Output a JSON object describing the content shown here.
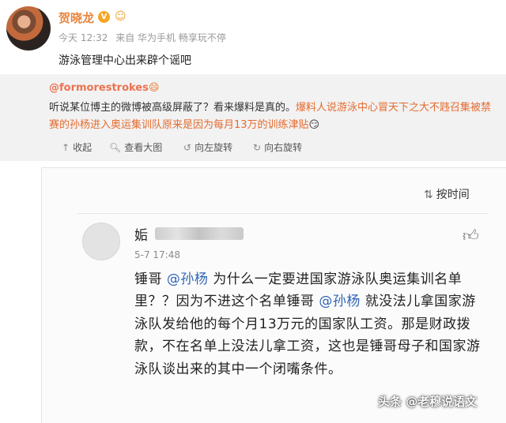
{
  "post": {
    "author": "贺晓龙",
    "verified_badge": "V",
    "meta": {
      "time": "今天 12:32",
      "source": "来自 华为手机 畅享玩不停"
    },
    "text": "游泳管理中心出来辟个谣吧"
  },
  "repost": {
    "author": "@formorestrokes",
    "text_a": "听说某位博主的微博被高级屏蔽了？看来爆料是真的。",
    "text_b": "爆料人说游泳中心冒天下之大不韪召集被禁赛的孙杨进入奥运集训队原来是因为每月13万的训练津贴",
    "actions": [
      {
        "icon": "collapse-icon",
        "label": "收起"
      },
      {
        "icon": "zoom-icon",
        "label": "查看大图"
      },
      {
        "icon": "rotate-left-icon",
        "label": "向左旋转"
      },
      {
        "icon": "rotate-right-icon",
        "label": "向右旋转"
      }
    ]
  },
  "comments": {
    "sort_label": "按时间",
    "item": {
      "name_initial": "姤",
      "time": "5-7 17:48",
      "t1": "锤哥",
      "m1": "@孙杨",
      "t2": "为什么一定要进国家游泳队奥运集训名单里？？因为不进这个名单锤哥",
      "m2": "@孙杨",
      "t3": "就没法儿拿国家游泳队发给他的每个月13万元的国家队工资。那是财政拨款，不在名单上没法儿拿工资，这也是锤哥母子和国家游泳队谈出来的其中一个闭嘴条件。"
    }
  },
  "watermark": "头条 @老穆说语文",
  "colors": {
    "author": "#e8853d",
    "mention": "#2f65b5",
    "repost_bg": "#f2f2f2"
  }
}
